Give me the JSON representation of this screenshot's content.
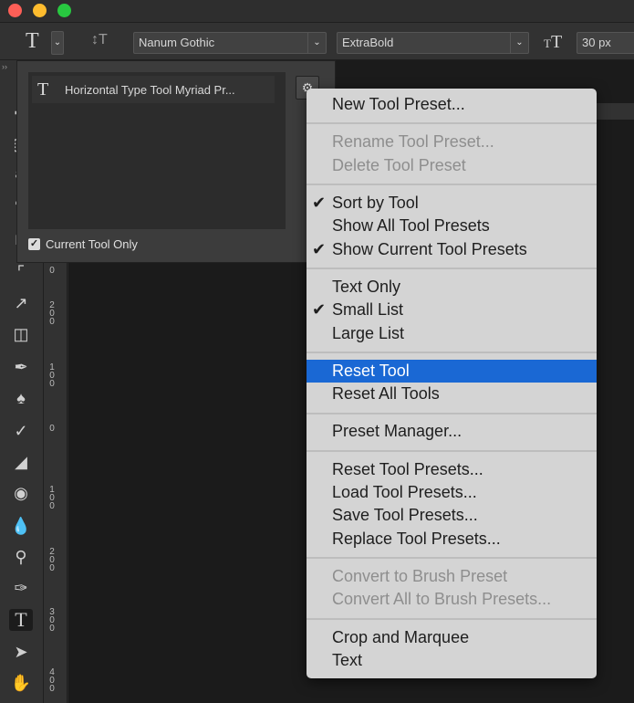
{
  "window": {
    "colors": {
      "close": "#fe5f57",
      "minimize": "#febc2e",
      "maximize": "#28c840"
    }
  },
  "options_bar": {
    "tool_icon": "type-tool-icon",
    "font_family": "Nanum Gothic",
    "font_style": "ExtraBold",
    "font_size": "30 px"
  },
  "toolbar": {
    "collapse_glyph": "››",
    "tools": [
      "move",
      "marquee",
      "lasso",
      "quick-select",
      "crop",
      "eyedropper",
      "healing",
      "brush",
      "clone-stamp",
      "history-brush",
      "eraser",
      "paint-bucket",
      "blur",
      "dodge",
      "pen",
      "type",
      "path-select",
      "hand"
    ],
    "active_tool": "type"
  },
  "ruler": {
    "labels": [
      "0",
      "2\n0\n0",
      "1\n0\n0",
      "0",
      "1\n0\n0",
      "2\n0\n0",
      "3\n0\n0",
      "4\n0\n0"
    ]
  },
  "preset_panel": {
    "item_label": "Horizontal Type Tool Myriad Pr...",
    "current_tool_only_label": "Current Tool Only",
    "current_tool_only_checked": true
  },
  "menu": {
    "highlight_color": "#1a68d4",
    "groups": [
      [
        {
          "label": "New Tool Preset...",
          "enabled": true,
          "checked": false
        }
      ],
      [
        {
          "label": "Rename Tool Preset...",
          "enabled": false,
          "checked": false
        },
        {
          "label": "Delete Tool Preset",
          "enabled": false,
          "checked": false
        }
      ],
      [
        {
          "label": "Sort by Tool",
          "enabled": true,
          "checked": true
        },
        {
          "label": "Show All Tool Presets",
          "enabled": true,
          "checked": false
        },
        {
          "label": "Show Current Tool Presets",
          "enabled": true,
          "checked": true
        }
      ],
      [
        {
          "label": "Text Only",
          "enabled": true,
          "checked": false
        },
        {
          "label": "Small List",
          "enabled": true,
          "checked": true
        },
        {
          "label": "Large List",
          "enabled": true,
          "checked": false
        }
      ],
      [
        {
          "label": "Reset Tool",
          "enabled": true,
          "checked": false,
          "highlighted": true
        },
        {
          "label": "Reset All Tools",
          "enabled": true,
          "checked": false
        }
      ],
      [
        {
          "label": "Preset Manager...",
          "enabled": true,
          "checked": false
        }
      ],
      [
        {
          "label": "Reset Tool Presets...",
          "enabled": true,
          "checked": false
        },
        {
          "label": "Load Tool Presets...",
          "enabled": true,
          "checked": false
        },
        {
          "label": "Save Tool Presets...",
          "enabled": true,
          "checked": false
        },
        {
          "label": "Replace Tool Presets...",
          "enabled": true,
          "checked": false
        }
      ],
      [
        {
          "label": "Convert to Brush Preset",
          "enabled": false,
          "checked": false
        },
        {
          "label": "Convert All to Brush Presets...",
          "enabled": false,
          "checked": false
        }
      ],
      [
        {
          "label": "Crop and Marquee",
          "enabled": true,
          "checked": false
        },
        {
          "label": "Text",
          "enabled": true,
          "checked": false
        }
      ]
    ]
  }
}
